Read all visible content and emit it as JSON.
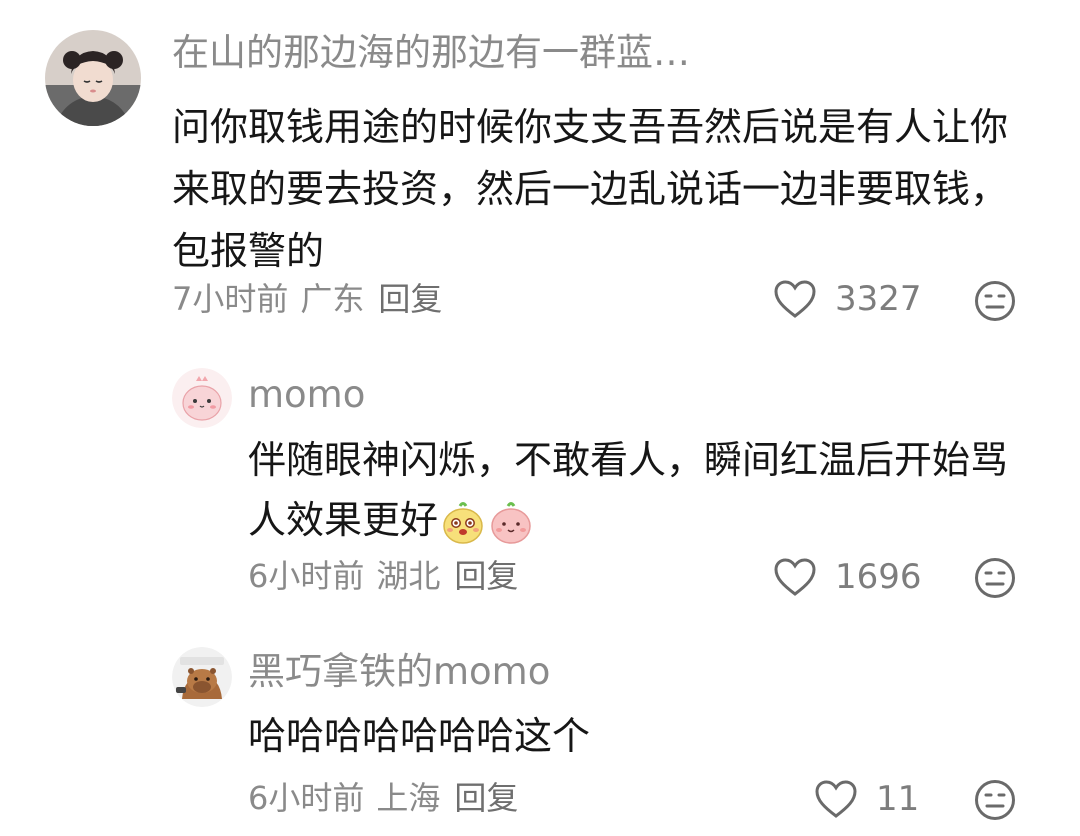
{
  "comments": [
    {
      "username": "在山的那边海的那边有一群蓝…",
      "text": "问你取钱用途的时候你支支吾吾然后说是有人让你来取的要去投资，然后一边乱说话一边非要取钱，包报警的",
      "time": "7小时前",
      "region": "广东",
      "reply_label": "回复",
      "likes": "3327",
      "avatar_icon": "girl-photo-avatar"
    },
    {
      "username": "momo",
      "text": "伴随眼神闪烁，不敢看人，瞬间红温后开始骂人效果更好",
      "emojis": [
        "yellow-bean-emoji",
        "pink-bean-emoji"
      ],
      "time": "6小时前",
      "region": "湖北",
      "reply_label": "回复",
      "likes": "1696",
      "avatar_icon": "pink-dino-avatar"
    },
    {
      "username": "黑巧拿铁的momo",
      "text": "哈哈哈哈哈哈哈这个",
      "time": "6小时前",
      "region": "上海",
      "reply_label": "回复",
      "likes": "11",
      "avatar_icon": "capybara-avatar"
    }
  ],
  "colors": {
    "meta_gray": "#8a8a8a",
    "text": "#161616",
    "icon_gray": "#6a6a6a"
  }
}
